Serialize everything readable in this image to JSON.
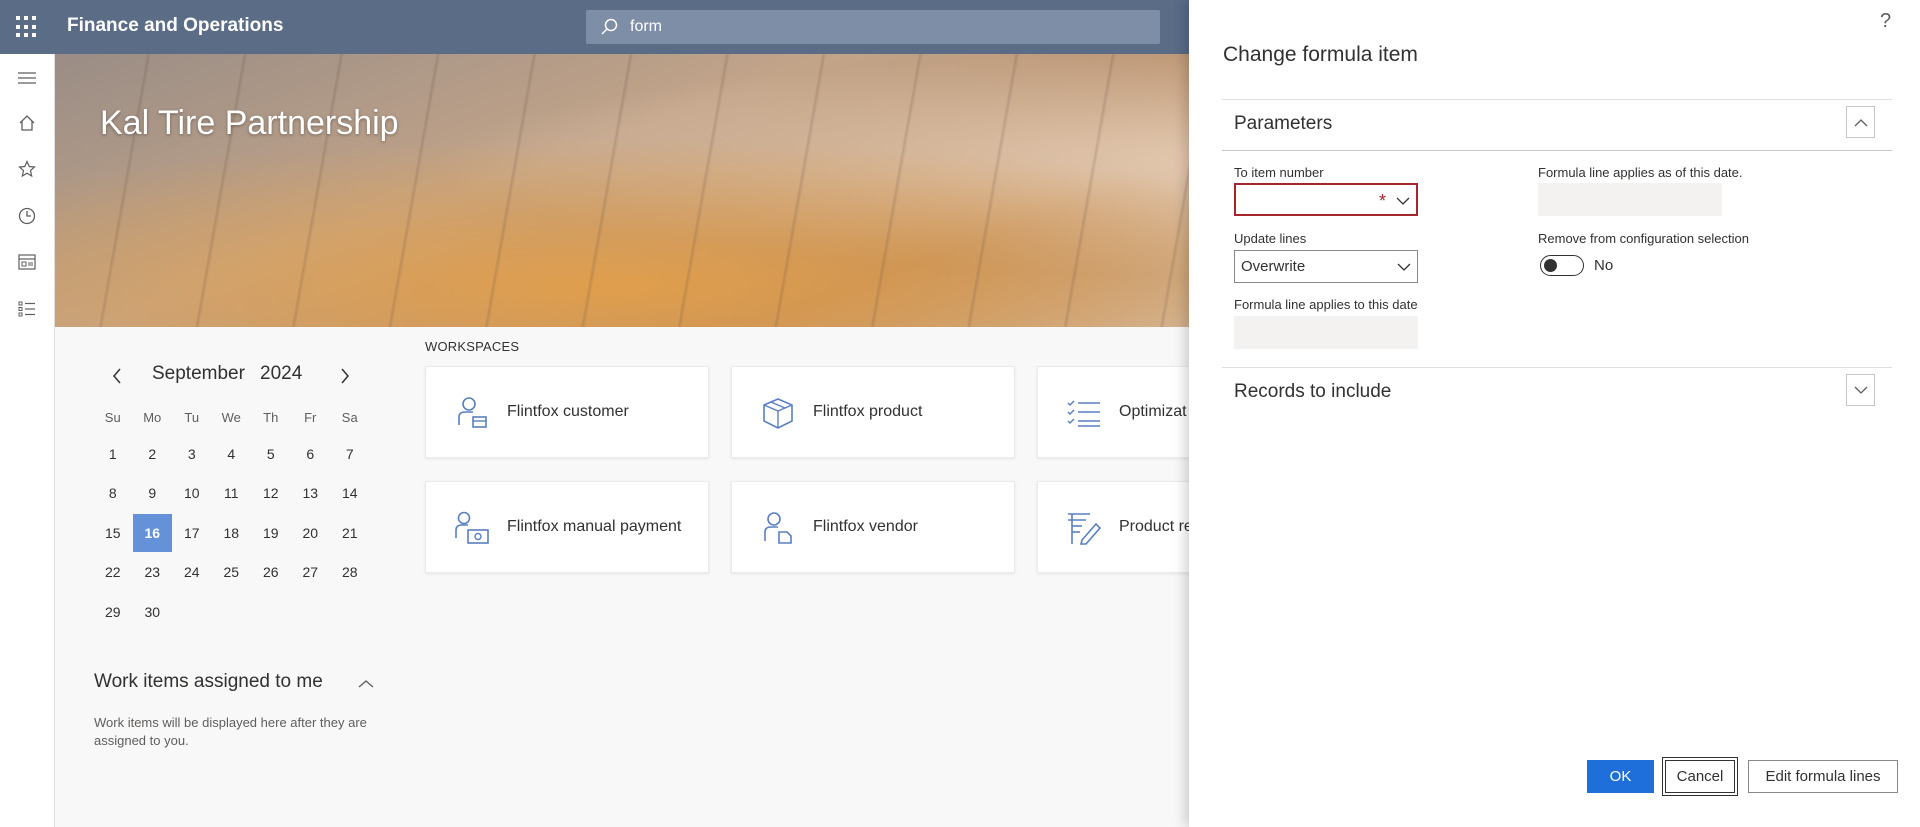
{
  "header": {
    "app_title": "Finance and Operations",
    "search_value": "form",
    "bar_color": "#5a6c86"
  },
  "leftnav": {
    "icons": [
      "hamburger-icon",
      "home-icon",
      "star-icon",
      "clock-icon",
      "workspace-icon",
      "list-icon"
    ]
  },
  "banner": {
    "title": "Kal Tire Partnership"
  },
  "calendar": {
    "month": "September",
    "year": "2024",
    "weekdays": [
      "Su",
      "Mo",
      "Tu",
      "We",
      "Th",
      "Fr",
      "Sa"
    ],
    "weeks": [
      [
        "1",
        "2",
        "3",
        "4",
        "5",
        "6",
        "7"
      ],
      [
        "8",
        "9",
        "10",
        "11",
        "12",
        "13",
        "14"
      ],
      [
        "15",
        "16",
        "17",
        "18",
        "19",
        "20",
        "21"
      ],
      [
        "22",
        "23",
        "24",
        "25",
        "26",
        "27",
        "28"
      ],
      [
        "29",
        "30",
        "",
        "",
        "",
        "",
        ""
      ]
    ],
    "selected_day": "16",
    "selected_color": "#6491d8"
  },
  "work_items": {
    "title": "Work items assigned to me",
    "description": "Work items will be displayed here after they are assigned to you."
  },
  "workspaces": {
    "label": "WORKSPACES",
    "tiles": [
      {
        "label": "Flintfox customer",
        "icon": "customer-icon"
      },
      {
        "label": "Flintfox product",
        "icon": "product-box-icon"
      },
      {
        "label": "Optimizat",
        "icon": "checklist-icon"
      },
      {
        "label": "Flintfox manual payment",
        "icon": "payment-icon"
      },
      {
        "label": "Flintfox vendor",
        "icon": "vendor-icon"
      },
      {
        "label": "Product re discrete m",
        "icon": "product-release-icon"
      }
    ]
  },
  "dialog": {
    "title": "Change formula item",
    "help": "?",
    "parameters": {
      "title": "Parameters",
      "to_item_label": "To item number",
      "to_item_value": "",
      "required_mark": "*",
      "update_lines_label": "Update lines",
      "update_lines_value": "Overwrite",
      "applies_to_label": "Formula line applies to this date",
      "applies_to_value": "",
      "applies_from_label": "Formula line applies as of this date.",
      "applies_from_value": "",
      "remove_config_label": "Remove from configuration selection",
      "remove_config_value": "No"
    },
    "records": {
      "title": "Records to include"
    },
    "buttons": {
      "ok": "OK",
      "cancel": "Cancel",
      "edit": "Edit formula lines"
    },
    "accent_color": "#1e6fd9"
  }
}
